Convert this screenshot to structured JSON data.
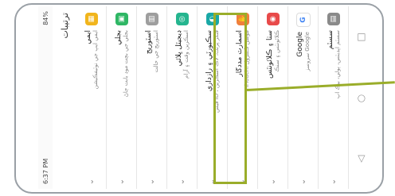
{
  "status": {
    "time": "6:37 PM",
    "battery": "84%"
  },
  "header": {
    "title": "ترتيبات"
  },
  "apps": [
    {
      "name": "ايمي",
      "desc": "ايمي ايپ جي نوٽيفڪيشن",
      "color": "#f1b51c",
      "icon": "▦"
    },
    {
      "name": "بجلي",
      "desc": "بجلي جي بچت موڊ بابت ڄاڻ",
      "color": "#2fb765",
      "icon": "▣"
    },
    {
      "name": "اسٽوريج",
      "desc": "اسٽوريج جي حالت",
      "color": "#9e9e9e",
      "icon": "▥"
    },
    {
      "name": "ڊيجيٽل ڀلائي",
      "desc": "اسڪرين وقت ۽ آرام",
      "color": "#25b58f",
      "icon": "◎"
    },
    {
      "name": "سڪيورٽي ۽ رازداري",
      "desc": "فيس ID ، فنگر پرنٽ، لاڪ اسڪرين",
      "color": "#1aa8a6",
      "icon": "◐"
    },
    {
      "name": "اسمارٽ مددگار",
      "desc": "HiTouch، موشن ڪنٽرول",
      "color": "#f0803c",
      "icon": "✋"
    },
    {
      "name": "سٺا ۽ ڪلائونٽس",
      "desc": "ڪلائونٽس ۽ سنڪ",
      "color": "#e84a4a",
      "icon": "◉"
    },
    {
      "name": "Google",
      "desc": "سروسز Google",
      "color": "#ffffff",
      "icon": "G"
    },
    {
      "name": "سسٽم",
      "desc": "سسٽم اپڊيٽس، ٻولي، بيڪ اپ",
      "color": "#8a8a8a",
      "icon": "▤"
    }
  ],
  "nav": {
    "back": "◁",
    "home": "○",
    "recent": "□"
  }
}
